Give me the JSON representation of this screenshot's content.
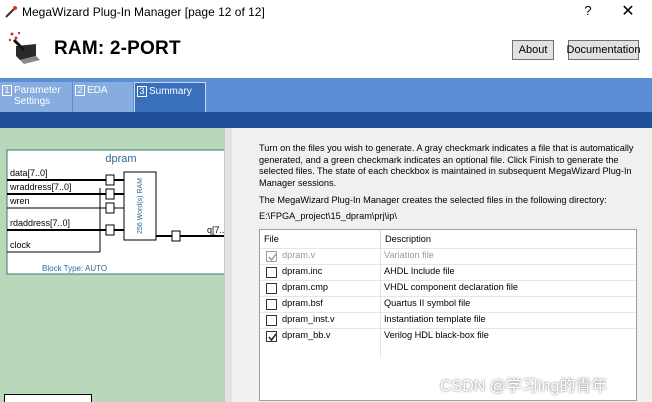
{
  "window": {
    "title": "MegaWizard Plug-In Manager [page 12 of 12]",
    "help_glyph": "?",
    "close_glyph": "✕"
  },
  "header": {
    "title": "RAM: 2-PORT",
    "about_label": "About",
    "documentation_label": "Documentation"
  },
  "tabs": [
    {
      "num": "1",
      "label": "Parameter Settings",
      "line1": "Parameter",
      "line2": "Settings"
    },
    {
      "num": "2",
      "label": "EDA"
    },
    {
      "num": "3",
      "label": "Summary"
    }
  ],
  "symbol": {
    "name": "dpram",
    "ports_in": [
      "data[7..0]",
      "wraddress[7..0]",
      "wren",
      "rdaddress[7..0]",
      "clock"
    ],
    "port_out": "q[7..0]",
    "core_label": "256 Word(s) RAM",
    "block_type": "Block Type: AUTO"
  },
  "summary": {
    "instructions": "Turn on the files you wish to generate. A gray checkmark indicates a file that is automatically generated, and a green checkmark indicates an optional file. Click Finish to generate the selected files. The state of each checkbox is maintained in subsequent MegaWizard Plug-In Manager sessions.",
    "directory_note": "The MegaWizard Plug-In Manager creates the selected files in the following directory:",
    "directory": "E:\\FPGA_project\\15_dpram\\prj\\ip\\",
    "columns": [
      "File",
      "Description"
    ],
    "files": [
      {
        "name": "dpram.v",
        "description": "Variation file",
        "checked": true,
        "auto": true
      },
      {
        "name": "dpram.inc",
        "description": "AHDL Include file",
        "checked": false,
        "auto": false
      },
      {
        "name": "dpram.cmp",
        "description": "VHDL component declaration file",
        "checked": false,
        "auto": false
      },
      {
        "name": "dpram.bsf",
        "description": "Quartus II symbol file",
        "checked": false,
        "auto": false
      },
      {
        "name": "dpram_inst.v",
        "description": "Instantiation template file",
        "checked": false,
        "auto": false
      },
      {
        "name": "dpram_bb.v",
        "description": "Verilog HDL black-box file",
        "checked": true,
        "auto": false
      }
    ]
  },
  "watermark": "CSDN @学习ing的青年"
}
